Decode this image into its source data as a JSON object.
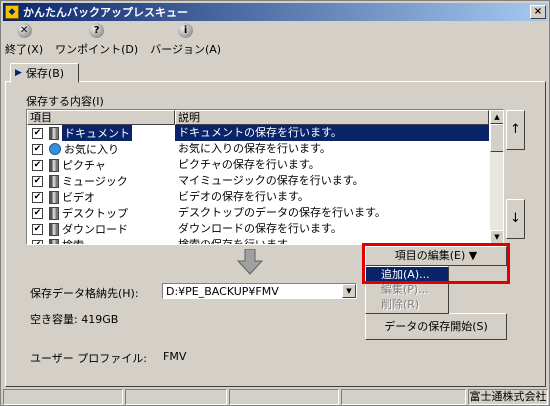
{
  "window": {
    "title": "かんたんバックアップレスキュー",
    "close_glyph": "×"
  },
  "toolbar": [
    {
      "icon": "close-circle-icon",
      "glyph": "✕",
      "label": "終了(X)"
    },
    {
      "icon": "help-circle-icon",
      "glyph": "?",
      "label": "ワンポイント(D)"
    },
    {
      "icon": "info-circle-icon",
      "glyph": "i",
      "label": "バージョン(A)"
    }
  ],
  "tab": {
    "label": "保存(B)"
  },
  "contents_label": "保存する内容(I)",
  "list": {
    "headers": [
      "項目",
      "説明"
    ],
    "rows": [
      {
        "name": "ドキュメント",
        "desc": "ドキュメントの保存を行います。",
        "checked": true,
        "selected": true,
        "icon": "folder-icon"
      },
      {
        "name": "お気に入り",
        "desc": "お気に入りの保存を行います。",
        "checked": true,
        "icon": "ie-icon"
      },
      {
        "name": "ピクチャ",
        "desc": "ピクチャの保存を行います。",
        "checked": true,
        "icon": "folder-icon"
      },
      {
        "name": "ミュージック",
        "desc": "マイミュージックの保存を行います。",
        "checked": true,
        "icon": "folder-icon"
      },
      {
        "name": "ビデオ",
        "desc": "ビデオの保存を行います。",
        "checked": true,
        "icon": "folder-icon"
      },
      {
        "name": "デスクトップ",
        "desc": "デスクトップのデータの保存を行います。",
        "checked": true,
        "icon": "desktop-icon"
      },
      {
        "name": "ダウンロード",
        "desc": "ダウンロードの保存を行います。",
        "checked": true,
        "icon": "folder-icon"
      },
      {
        "name": "検索",
        "desc": "検索の保存を行います。",
        "checked": true,
        "icon": "folder-icon"
      }
    ]
  },
  "side_buttons": {
    "up": "↑",
    "down": "↓"
  },
  "edit": {
    "button_label": "項目の編集(E) ▼",
    "menu": [
      {
        "label": "追加(A)...",
        "state": "highlighted"
      },
      {
        "label": "編集(P)...",
        "state": "disabled"
      },
      {
        "label": "削除(R)",
        "state": "disabled"
      }
    ]
  },
  "destination": {
    "label": "保存データ格納先(H):",
    "value": "D:¥PE_BACKUP¥FMV"
  },
  "free_space": "空き容量: 419GB",
  "start_button": "データの保存開始(S)",
  "profile": {
    "label": "ユーザー プロファイル:",
    "value": "FMV"
  },
  "status": {
    "company": "富士通株式会社"
  },
  "colors": {
    "selection": "#0a246a",
    "highlight_box": "#e00000"
  }
}
